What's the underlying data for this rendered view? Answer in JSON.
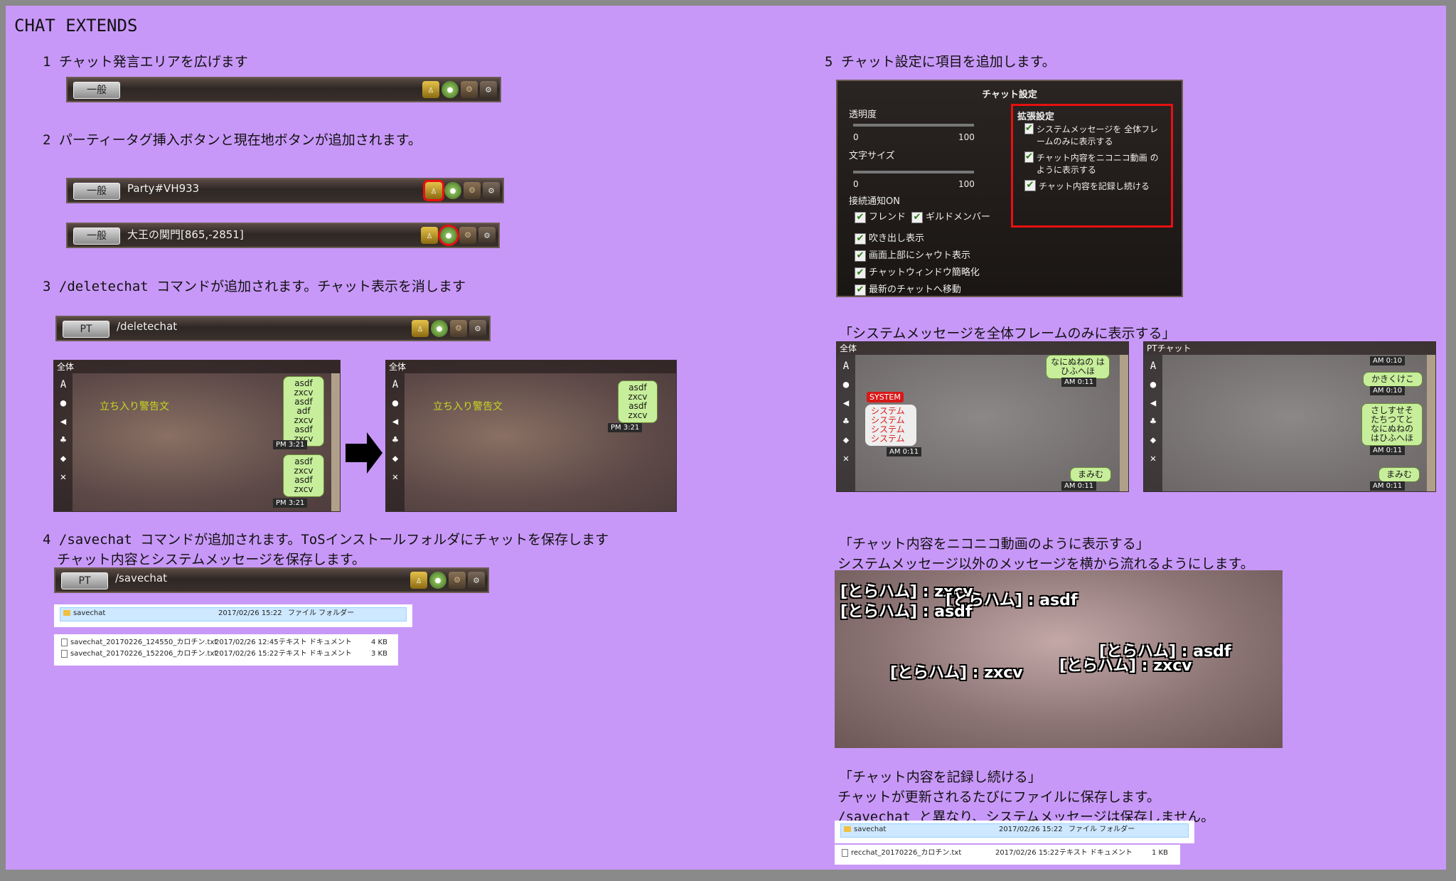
{
  "title": "CHAT EXTENDS",
  "sections": {
    "s1": "1 チャット発言エリアを広げます",
    "s2": "2 パーティータグ挿入ボタンと現在地ボタンが追加されます。",
    "s3": "3 /deletechat コマンドが追加されます。チャット表示を消します",
    "s4a": "4 /savechat コマンドが追加されます。ToSインストールフォルダにチャットを保存します",
    "s4b": "チャット内容とシステムメッセージを保存します。",
    "s5": "5 チャット設定に項目を追加します。",
    "q1": "「システムメッセージを全体フレームのみに表示する」",
    "q2": "「チャット内容をニコニコ動画のように表示する」",
    "q2b": "システムメッセージ以外のメッセージを横から流れるようにします。",
    "q3": "「チャット内容を記録し続ける」",
    "q3b": "チャットが更新されるたびにファイルに保存します。",
    "q3c": "/savechat と異なり、システムメッセージは保存しません。"
  },
  "bars": {
    "bar1": {
      "tag": "一般",
      "text": ""
    },
    "bar2": {
      "tag": "一般",
      "text": "Party#VH933"
    },
    "bar3": {
      "tag": "一般",
      "text": "大王の関門[865,-2851]"
    },
    "bar4": {
      "tag": "PT",
      "text": "/deletechat"
    },
    "bar5": {
      "tag": "PT",
      "text": "/savechat"
    }
  },
  "chatbox": {
    "tab_all": "全体",
    "tab_pt": "PTチャット",
    "warning": "立ち入り警告文",
    "msg_a": "asdf zxcv asdf adf zxcv asdf zxcv",
    "msg_b": "asdf zxcv asdf zxcv",
    "msg_c": "asdf zxcv asdf zxcv",
    "time_pm": "PM 3:21",
    "system_badge": "SYSTEM",
    "system_text": "システム システム システム システム",
    "time_am011": "AM 0:11",
    "time_am010": "AM 0:10",
    "nanine": "なにぬねの はひふへほ",
    "mamimu": "まみむ",
    "kakiku": "かきくけこ",
    "sashi": "さしすせそ たちつてと なにぬねの はひふへほ"
  },
  "files1": {
    "folder": {
      "name": "savechat",
      "date": "2017/02/26 15:22",
      "type": "ファイル フォルダー"
    },
    "f1": {
      "name": "savechat_20170226_124550_カロチン.txt",
      "date": "2017/02/26 12:45",
      "type": "テキスト ドキュメント",
      "size": "4 KB"
    },
    "f2": {
      "name": "savechat_20170226_152206_カロチン.txt",
      "date": "2017/02/26 15:22",
      "type": "テキスト ドキュメント",
      "size": "3 KB"
    }
  },
  "files2": {
    "folder": {
      "name": "savechat",
      "date": "2017/02/26 15:22",
      "type": "ファイル フォルダー"
    },
    "f1": {
      "name": "recchat_20170226_カロチン.txt",
      "date": "2017/02/26 15:22",
      "type": "テキスト ドキュメント",
      "size": "1 KB"
    }
  },
  "settings": {
    "title": "チャット設定",
    "opacity": "透明度",
    "fontsize": "文字サイズ",
    "min": "0",
    "max": "100",
    "connect": "接続通知ON",
    "friend": "フレンド",
    "guild": "ギルドメンバー",
    "balloon": "吹き出し表示",
    "shout": "画面上部にシャウト表示",
    "simple": "チャットウィンドウ簡略化",
    "latest": "最新のチャットへ移動",
    "ext_title": "拡張設定",
    "ext1": "システムメッセージを 全体フレームのみに表示する",
    "ext2": "チャット内容をニコニコ動画 のように表示する",
    "ext3": "チャット内容を記録し続ける"
  },
  "nico": {
    "m1": "[とらハム] : zxcv",
    "m2": "[とらハム] : asdf",
    "m3": "[とらハム] : asdf",
    "m4": "[とらハム] : asdf",
    "m5": "[とらハム] : zxcv",
    "m6": "[とらハム] : zxcv"
  },
  "icons": [
    "party-tag-icon",
    "location-icon",
    "emoticon-icon",
    "gear-icon",
    "arrow-right-icon",
    "folder-icon",
    "text-file-icon",
    "checkbox-icon"
  ]
}
